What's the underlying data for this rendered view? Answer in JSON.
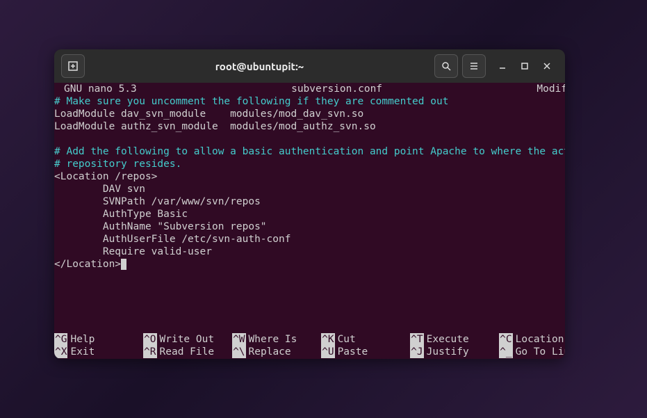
{
  "titlebar": {
    "title": "root@ubuntupit:~"
  },
  "editor": {
    "app": "GNU nano 5.3",
    "filename": "subversion.conf",
    "status": "Modified"
  },
  "content": {
    "l1": "# Make sure you uncomment the following if they are commented out",
    "l2": "LoadModule dav_svn_module    modules/mod_dav_svn.so",
    "l3": "LoadModule authz_svn_module  modules/mod_authz_svn.so",
    "l4": "",
    "l5": "# Add the following to allow a basic authentication and point Apache to where the actual",
    "l6": "# repository resides.",
    "l7": "<Location /repos>",
    "l8": "        DAV svn",
    "l9": "        SVNPath /var/www/svn/repos",
    "l10": "        AuthType Basic",
    "l11": "        AuthName \"Subversion repos\"",
    "l12": "        AuthUserFile /etc/svn-auth-conf",
    "l13": "        Require valid-user",
    "l14": "</Location>"
  },
  "shortcuts": {
    "r1c1": {
      "key": "^G",
      "label": "Help"
    },
    "r1c2": {
      "key": "^O",
      "label": "Write Out"
    },
    "r1c3": {
      "key": "^W",
      "label": "Where Is"
    },
    "r1c4": {
      "key": "^K",
      "label": "Cut"
    },
    "r1c5": {
      "key": "^T",
      "label": "Execute"
    },
    "r1c6": {
      "key": "^C",
      "label": "Location"
    },
    "r2c1": {
      "key": "^X",
      "label": "Exit"
    },
    "r2c2": {
      "key": "^R",
      "label": "Read File"
    },
    "r2c3": {
      "key": "^\\",
      "label": "Replace"
    },
    "r2c4": {
      "key": "^U",
      "label": "Paste"
    },
    "r2c5": {
      "key": "^J",
      "label": "Justify"
    },
    "r2c6": {
      "key": "^_",
      "label": "Go To Line"
    }
  }
}
